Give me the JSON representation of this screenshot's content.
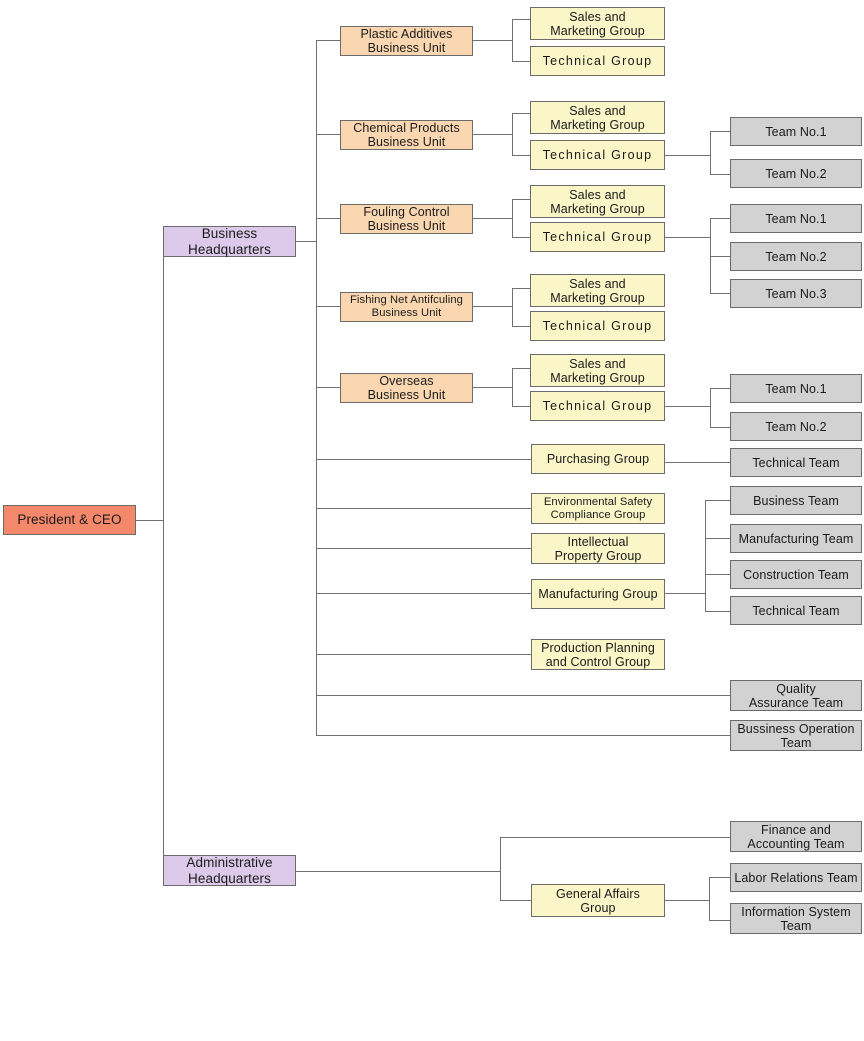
{
  "title": "Organization Chart",
  "colors": {
    "ceo": "#f4886a",
    "headquarters": "#ddcaea",
    "business_unit": "#fad7b0",
    "group": "#faf6c8",
    "team": "#d2d2d2",
    "line": "#707070",
    "border": "#6b6b6b"
  },
  "root": {
    "label": "President & CEO"
  },
  "headquarters": [
    {
      "label": "Business Headquarters"
    },
    {
      "label": "Administrative Headquarters"
    }
  ],
  "business_units": [
    {
      "label": "Plastic Additives\nBusiness Unit",
      "line1": "Plastic Additives",
      "line2": "Business Unit"
    },
    {
      "label": "Chemical Products\nBusiness Unit",
      "line1": "Chemical Products",
      "line2": "Business Unit"
    },
    {
      "label": "Fouling Control\nBusiness Unit",
      "line1": "Fouling Control",
      "line2": "Business Unit"
    },
    {
      "label": "Fishing Net Antifculing\nBusiness Unit",
      "line1": "Fishing Net Antifculing",
      "line2": "Business Unit"
    },
    {
      "label": "Overseas\nBusiness Unit",
      "line1": "Overseas",
      "line2": "Business Unit"
    }
  ],
  "unit_groups": {
    "sales_line1": "Sales and",
    "sales_line2": "Marketing Group",
    "technical": "Technical Group"
  },
  "groups": [
    {
      "label": "Purchasing Group",
      "line1": "Purchasing Group",
      "line2": ""
    },
    {
      "label": "Environmental Safety Compliance Group",
      "line1": "Environmental Safety",
      "line2": "Compliance Group"
    },
    {
      "label": "Intellectual Property Group",
      "line1": "Intellectual",
      "line2": "Property Group"
    },
    {
      "label": "Manufacturing Group",
      "line1": "Manufacturing Group",
      "line2": ""
    },
    {
      "label": "Production Planning and Control Group",
      "line1": "Production Planning",
      "line2": "and Control Group"
    }
  ],
  "teams": {
    "chemical_products": [
      {
        "label": "Team No.1"
      },
      {
        "label": "Team No.2"
      }
    ],
    "fouling_control": [
      {
        "label": "Team No.1"
      },
      {
        "label": "Team No.2"
      },
      {
        "label": "Team No.3"
      }
    ],
    "overseas": [
      {
        "label": "Team No.1"
      },
      {
        "label": "Team No.2"
      }
    ],
    "purchasing": [
      {
        "label": "Technical Team"
      }
    ],
    "manufacturing": [
      {
        "label": "Business Team"
      },
      {
        "label": "Manufacturing Team"
      },
      {
        "label": "Construction Team"
      },
      {
        "label": "Technical Team"
      }
    ],
    "business_hq_direct": [
      {
        "line1": "Quality",
        "line2": "Assurance Team"
      },
      {
        "line1": "Bussiness Operation",
        "line2": "Team"
      }
    ],
    "administrative": [
      {
        "line1": "Finance and",
        "line2": "Accounting Team"
      }
    ],
    "general_affairs": [
      {
        "line1": "Labor Relations Team",
        "line2": ""
      },
      {
        "line1": "Information System",
        "line2": "Team"
      }
    ]
  },
  "admin_groups": [
    {
      "line1": "General Affairs",
      "line2": "Group"
    }
  ]
}
